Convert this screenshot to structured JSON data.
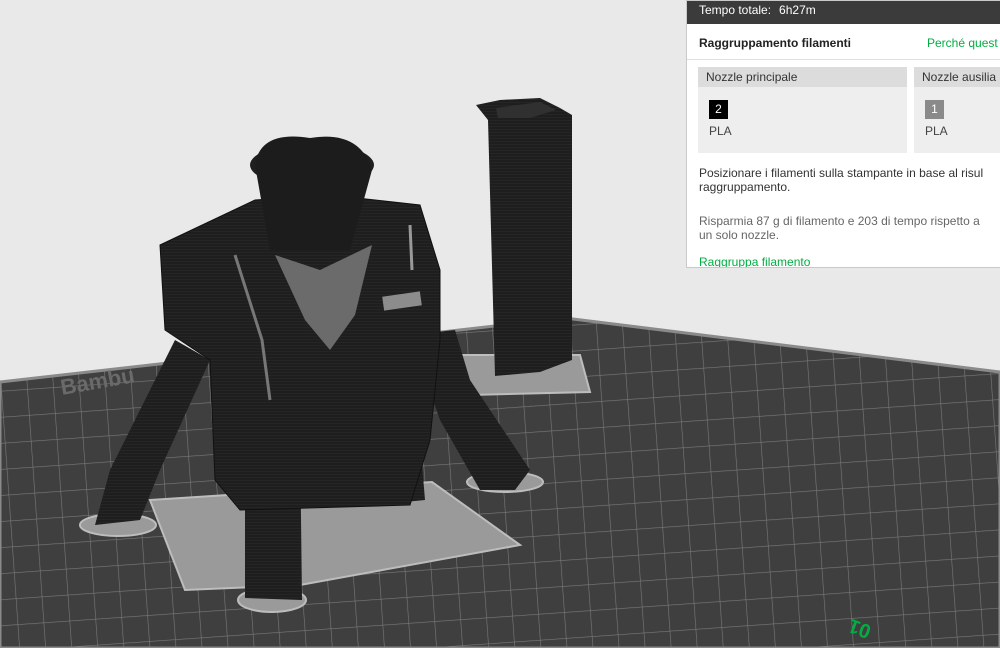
{
  "panel": {
    "total_time_label": "Tempo totale:",
    "total_time_value": "6h27m",
    "title": "Raggruppamento filamenti",
    "why_link": "Perché quest",
    "nozzles": [
      {
        "name": "Nozzle principale",
        "slot": "2",
        "slot_color": "#000000",
        "material": "PLA"
      },
      {
        "name": "Nozzle ausilia",
        "slot": "1",
        "slot_color": "#8a8a8a",
        "material": "PLA"
      }
    ],
    "instruction": "Posizionare i filamenti sulla stampante in base al risul\nraggruppamento.",
    "savings": "Risparmia 87 g di filamento e 203 di tempo rispetto a\nun solo nozzle.",
    "action_link": "Raggruppa filamento"
  },
  "viewport": {
    "bed_brand": "Bambu",
    "bed_corner_mark": "01",
    "bed_color": "#3d3d3d",
    "model_color": "#1c1c1c",
    "accent": "#00ae42"
  }
}
